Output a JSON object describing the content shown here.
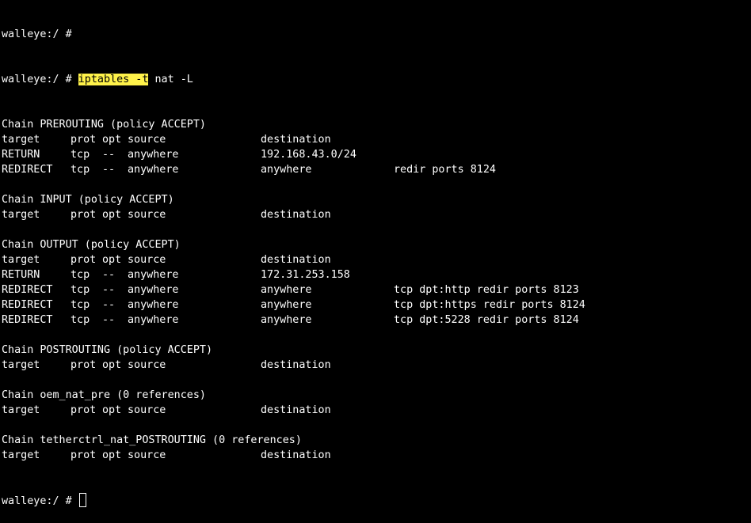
{
  "terminal": {
    "prompt": "walleye:/ #",
    "prev_prompt": "walleye:/ #",
    "command_highlight": "iptables -t",
    "command_rest": " nat -L",
    "headers": {
      "target": "target",
      "prot": "prot",
      "opt": "opt",
      "source": "source",
      "destination": "destination"
    },
    "chains": [
      {
        "title": "Chain PREROUTING (policy ACCEPT)",
        "rules": [
          {
            "target": "RETURN",
            "prot": "tcp",
            "opt": "--",
            "source": "anywhere",
            "destination": "192.168.43.0/24",
            "extra": ""
          },
          {
            "target": "REDIRECT",
            "prot": "tcp",
            "opt": "--",
            "source": "anywhere",
            "destination": "anywhere",
            "extra": "redir ports 8124"
          }
        ]
      },
      {
        "title": "Chain INPUT (policy ACCEPT)",
        "rules": []
      },
      {
        "title": "Chain OUTPUT (policy ACCEPT)",
        "rules": [
          {
            "target": "RETURN",
            "prot": "tcp",
            "opt": "--",
            "source": "anywhere",
            "destination": "172.31.253.158",
            "extra": ""
          },
          {
            "target": "REDIRECT",
            "prot": "tcp",
            "opt": "--",
            "source": "anywhere",
            "destination": "anywhere",
            "extra": "tcp dpt:http redir ports 8123"
          },
          {
            "target": "REDIRECT",
            "prot": "tcp",
            "opt": "--",
            "source": "anywhere",
            "destination": "anywhere",
            "extra": "tcp dpt:https redir ports 8124"
          },
          {
            "target": "REDIRECT",
            "prot": "tcp",
            "opt": "--",
            "source": "anywhere",
            "destination": "anywhere",
            "extra": "tcp dpt:5228 redir ports 8124"
          }
        ]
      },
      {
        "title": "Chain POSTROUTING (policy ACCEPT)",
        "rules": []
      },
      {
        "title": "Chain oem_nat_pre (0 references)",
        "rules": []
      },
      {
        "title": "Chain tetherctrl_nat_POSTROUTING (0 references)",
        "rules": []
      }
    ],
    "colors": {
      "background": "#000000",
      "text": "#ffffff",
      "highlight": "#fff24a"
    }
  }
}
